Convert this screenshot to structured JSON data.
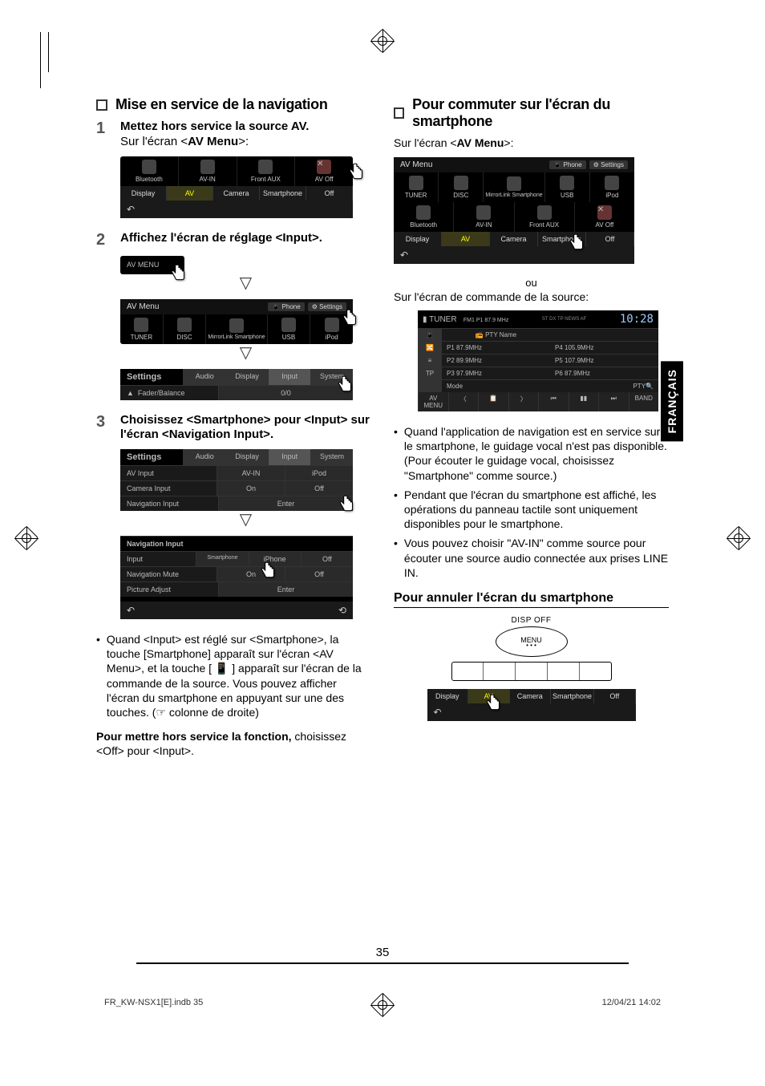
{
  "lang_tab": "FRANÇAIS",
  "page_number": "35",
  "footer": {
    "left": "FR_KW-NSX1[E].indb   35",
    "right": "12/04/21   14:02"
  },
  "left": {
    "section_title": "Mise en service de la navigation",
    "step1": {
      "num": "1",
      "title": "Mettez hors service la source AV.",
      "sub_pre": "Sur l'écran <",
      "sub_bold": "AV Menu",
      "sub_post": ">:"
    },
    "step2": {
      "num": "2",
      "title": "Affichez l'écran de réglage <Input>."
    },
    "step3": {
      "num": "3",
      "title": "Choisissez <Smartphone> pour <Input> sur l'écran <Navigation Input>."
    },
    "avmenu_small_label": "AV MENU",
    "bullet_text": "Quand <Input> est réglé sur <Smartphone>, la touche [Smartphone] apparaît sur l'écran <AV Menu>, et la touche [ 📱 ] apparaît sur l'écran de la commande de la source. Vous pouvez afficher l'écran du smartphone en appuyant sur une des touches. (☞ colonne de droite)",
    "disable_note": {
      "bold": "Pour mettre hors service la fonction,",
      "rest": " choisissez <Off> pour <Input>."
    },
    "ss1": {
      "row1": [
        "Bluetooth",
        "AV-IN",
        "Front AUX",
        "AV Off"
      ],
      "tabs": [
        "Display",
        "AV",
        "Camera",
        "Smartphone",
        "Off"
      ]
    },
    "ss2": {
      "header": "AV Menu",
      "pills": [
        "📱 Phone",
        "⚙ Settings"
      ],
      "row": [
        "TUNER",
        "DISC",
        "MirrorLink Smartphone",
        "USB",
        "iPod"
      ],
      "settings_title": "Settings",
      "settings_tabs": [
        "Audio",
        "Display",
        "Input",
        "System"
      ],
      "fader": "Fader/Balance",
      "fader_val": "0/0"
    },
    "ss3a": {
      "title": "Settings",
      "tabs": [
        "Audio",
        "Display",
        "Input",
        "System"
      ],
      "rows": [
        {
          "label": "AV Input",
          "opts": [
            "AV-IN",
            "iPod"
          ]
        },
        {
          "label": "Camera Input",
          "opts": [
            "On",
            "Off"
          ]
        },
        {
          "label": "Navigation Input",
          "opts": [
            "Enter"
          ]
        }
      ]
    },
    "ss3b": {
      "title": "Navigation Input",
      "rows": [
        {
          "label": "Input",
          "opts": [
            "Smartphone",
            "iPhone",
            "Off"
          ]
        },
        {
          "label": "Navigation Mute",
          "opts": [
            "On",
            "Off"
          ]
        },
        {
          "label": "Picture Adjust",
          "opts": [
            "Enter"
          ]
        }
      ]
    }
  },
  "right": {
    "section_title": "Pour commuter sur l'écran du smartphone",
    "sub": {
      "pre": "Sur l'écran <",
      "bold": "AV Menu",
      "post": ">:"
    },
    "ou": "ou",
    "sub2": "Sur l'écran de commande de la source:",
    "ss_menu": {
      "header": "AV Menu",
      "pills": [
        "📱 Phone",
        "⚙ Settings"
      ],
      "row1": [
        "TUNER",
        "DISC",
        "MirrorLink Smartphone",
        "USB",
        "iPod"
      ],
      "row2": [
        "Bluetooth",
        "AV-IN",
        "Front AUX",
        "AV Off"
      ],
      "tabs": [
        "Display",
        "AV",
        "Camera",
        "Smartphone",
        "Off"
      ]
    },
    "ss_tuner": {
      "title": "TUNER",
      "band": "FM1 P1 87.9 MHz",
      "flags": "ST   DX   TP   NEWS   AF",
      "time": "10:28",
      "pty": "PTY Name",
      "presets": [
        {
          "l": "P1 87.9MHz",
          "r": "P4 105.9MHz"
        },
        {
          "l": "P2 89.9MHz",
          "r": "P5 107.9MHz"
        },
        {
          "l": "P3 97.9MHz",
          "r": "P6 87.9MHz"
        }
      ],
      "left_btns": [
        "📱",
        "🔀",
        "≡",
        "TP"
      ],
      "mode": "Mode",
      "pty_btn": "PTY🔍",
      "bottom": [
        "AV MENU",
        "〈",
        "📋",
        "〉",
        "⏮",
        "▮▮",
        "⏭",
        "BAND"
      ]
    },
    "bullets": [
      "Quand l'application de navigation est en service sur le smartphone, le guidage vocal n'est pas disponible. (Pour écouter le guidage vocal, choisissez \"Smartphone\" comme source.)",
      "Pendant que l'écran du smartphone est affiché, les opérations du panneau tactile sont uniquement disponibles pour le smartphone.",
      "Vous pouvez choisir \"AV-IN\" comme source pour écouter une source audio connectée aux prises LINE IN."
    ],
    "cancel_head": "Pour annuler l'écran du smartphone",
    "disp_off": {
      "label": "DISP OFF",
      "menu": "MENU",
      "dots": "• • •"
    },
    "ss_cancel": {
      "tabs": [
        "Display",
        "AV",
        "Camera",
        "Smartphone",
        "Off"
      ]
    }
  }
}
